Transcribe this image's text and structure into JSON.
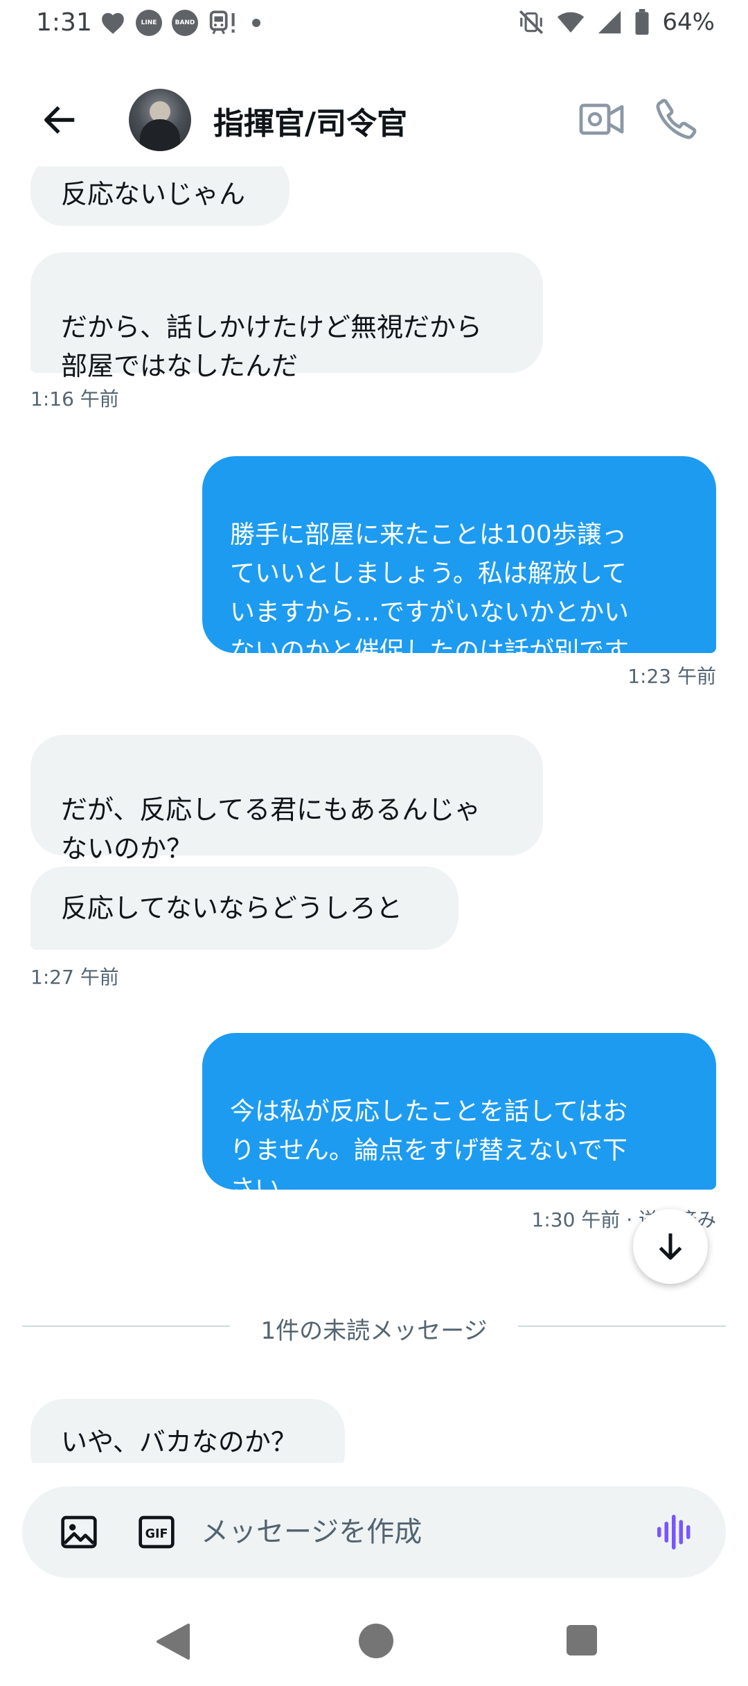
{
  "status_bar": {
    "time": "1:31",
    "battery": "64%",
    "app_icons": [
      "heart-icon",
      "line-icon",
      "band-icon",
      "train-alert-icon"
    ],
    "line_label": "LINE",
    "band_label": "BAND"
  },
  "header": {
    "contact_name": "指揮官/司令官"
  },
  "messages": [
    {
      "dir": "in",
      "text": "反応ないじゃん"
    },
    {
      "dir": "in",
      "text": "だから、話しかけたけど無視だから\n部屋ではなしたんだ"
    },
    {
      "dir": "in_ts",
      "text": "1:16 午前"
    },
    {
      "dir": "out",
      "text": "勝手に部屋に来たことは100歩譲っ\nていいとしましょう。私は解放して\nいますから…ですがいないかとかい\nないのかと催促したのは話が別です"
    },
    {
      "dir": "out_ts",
      "text": "1:23 午前"
    },
    {
      "dir": "in",
      "text": "だが、反応してる君にもあるんじゃ\nないのか？"
    },
    {
      "dir": "in",
      "text": "反応してないならどうしろと"
    },
    {
      "dir": "in_ts",
      "text": "1:27 午前"
    },
    {
      "dir": "out",
      "text": "今は私が反応したことを話してはお\nりません。論点をすげ替えないで下\nさい"
    },
    {
      "dir": "out_ts",
      "text": "1:30 午前 · 送信済み"
    },
    {
      "dir": "in",
      "text": "いや、バカなのか？"
    }
  ],
  "unread_divider": "1件の未読メッセージ",
  "composer": {
    "placeholder": "メッセージを作成",
    "gif_label": "GIF"
  },
  "colors": {
    "outgoing_bubble": "#1d9bf0",
    "incoming_bubble": "#eff3f4",
    "voice_accent": "#7856ff"
  }
}
